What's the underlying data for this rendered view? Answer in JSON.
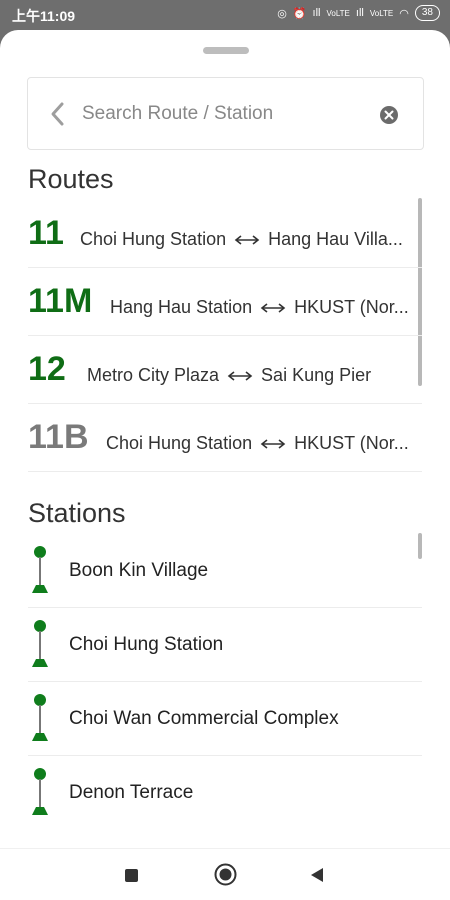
{
  "status_bar": {
    "time": "上午11:09",
    "network_1": "ıll",
    "network_2": "VoLTE",
    "network_3": "ıll",
    "network_4": "VoLTE",
    "battery": "38"
  },
  "search": {
    "placeholder": "Search Route / Station",
    "value": ""
  },
  "routes": {
    "title": "Routes",
    "arrow_glyph": "⟷",
    "items": [
      {
        "number": "11",
        "from": "Choi Hung Station",
        "to": "Hang Hau Villa...",
        "active": true
      },
      {
        "number": "11M",
        "from": "Hang Hau Station",
        "to": "HKUST (Nor...",
        "active": true
      },
      {
        "number": "12",
        "from": "Metro City Plaza",
        "to": "Sai Kung Pier",
        "active": true
      },
      {
        "number": "11B",
        "from": "Choi Hung Station",
        "to": "HKUST (Nor...",
        "active": false
      }
    ]
  },
  "stations": {
    "title": "Stations",
    "items": [
      {
        "name": "Boon Kin Village"
      },
      {
        "name": "Choi Hung Station"
      },
      {
        "name": "Choi Wan Commercial Complex"
      },
      {
        "name": "Denon Terrace"
      }
    ]
  },
  "colors": {
    "route_active": "#0f6d15",
    "route_inactive": "#7a7a7a",
    "stop_icon": "#0f7d1c"
  },
  "icons": {
    "back": "chevron-left-icon",
    "clear": "clear-circle-icon",
    "route_arrow": "bidirectional-arrow-icon",
    "station": "bus-stop-icon",
    "nav_recent": "recent-apps-icon",
    "nav_home": "home-icon",
    "nav_back": "back-triangle-icon"
  }
}
